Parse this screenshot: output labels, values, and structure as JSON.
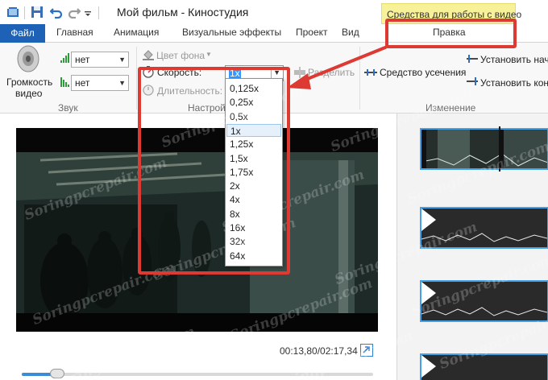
{
  "window": {
    "title": "Мой фильм - Киностудия",
    "context_tab_header": "Средства для работы с видео"
  },
  "tabs": {
    "file": "Файл",
    "home": "Главная",
    "animation": "Анимация",
    "visual_effects": "Визуальные эффекты",
    "project": "Проект",
    "view": "Вид",
    "edit": "Правка"
  },
  "ribbon": {
    "sound": {
      "volume_label_line1": "Громкость",
      "volume_label_line2": "видео",
      "fade_in_value": "нет",
      "fade_out_value": "нет",
      "group_label": "Звук"
    },
    "settings": {
      "bg_color_label": "Цвет фона",
      "speed_label": "Скорость:",
      "speed_value": "1x",
      "duration_label": "Длительность:",
      "group_label": "Настрой"
    },
    "edit": {
      "split_label": "Разделить",
      "trim_label": "Средство усечения",
      "set_start_label": "Установить нача",
      "set_end_label": "Установить конец",
      "group_label": "Изменение"
    }
  },
  "speed_options": [
    "0,125x",
    "0,25x",
    "0,5x",
    "1x",
    "1,25x",
    "1,5x",
    "1,75x",
    "2x",
    "4x",
    "8x",
    "16x",
    "32x",
    "64x"
  ],
  "speed_selected_index": 3,
  "player": {
    "time": "00:13,80/02:17,34",
    "seek_progress": 0.1
  },
  "watermark_text": "Soringpcrepair.com",
  "colors": {
    "accent": "#1e62b8",
    "highlight_red": "#dc3a32",
    "context_yellow": "#f7f29a",
    "storyboard_border": "#45a1e6"
  }
}
